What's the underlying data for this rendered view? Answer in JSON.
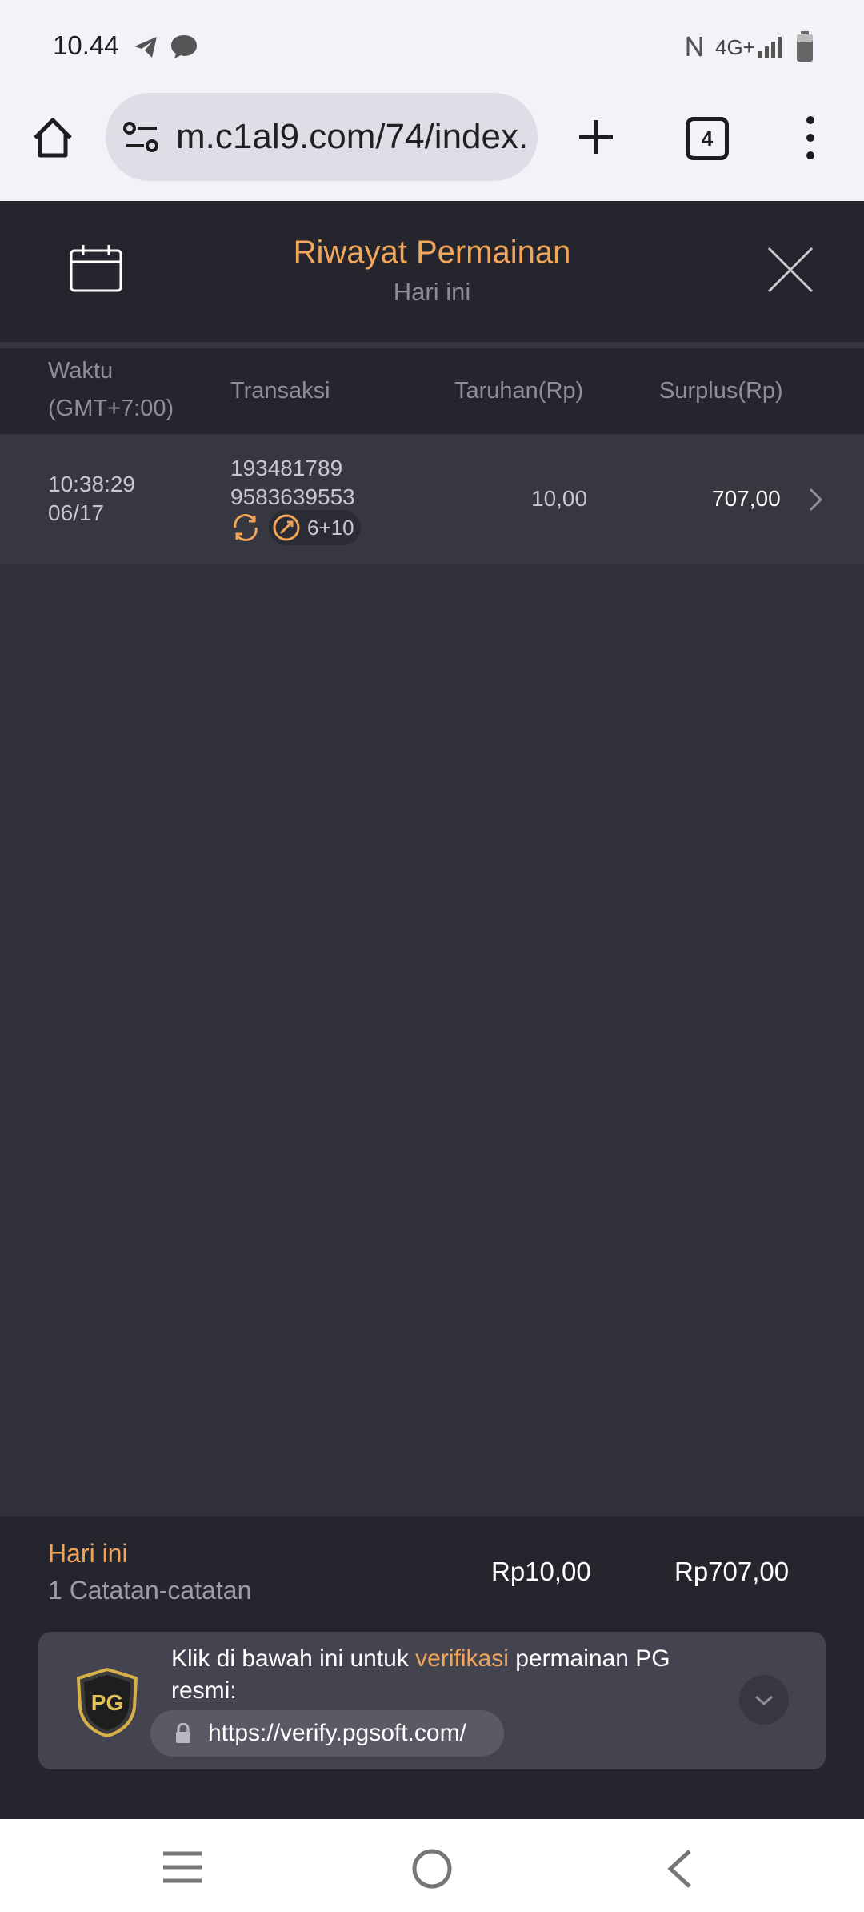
{
  "status_bar": {
    "time": "10.44",
    "network": "4G+"
  },
  "browser": {
    "url": "m.c1al9.com/74/index.",
    "tab_count": "4"
  },
  "header": {
    "title": "Riwayat Permainan",
    "subtitle": "Hari ini"
  },
  "table": {
    "columns": {
      "time_line1": "Waktu",
      "time_line2": "(GMT+7:00)",
      "transaction": "Transaksi",
      "bet": "Taruhan(Rp)",
      "surplus": "Surplus(Rp)"
    },
    "rows": [
      {
        "time": "10:38:29",
        "date": "06/17",
        "tx_line1": "193481789",
        "tx_line2": "9583639553",
        "badge": "6+10",
        "bet": "10,00",
        "surplus": "707,00"
      }
    ]
  },
  "summary": {
    "label": "Hari ini",
    "count": "1 Catatan-catatan",
    "total_bet": "Rp10,00",
    "total_surplus": "Rp707,00"
  },
  "verify": {
    "logo_text": "PG",
    "text_before": "Klik di bawah ini untuk ",
    "text_highlight": "verifikasi",
    "text_after": " permainan PG resmi:",
    "link": "https://verify.pgsoft.com/"
  },
  "colors": {
    "accent": "#f2a65a",
    "header_bg": "#25252d",
    "body_bg": "#30303a",
    "row_bg": "#373740"
  }
}
